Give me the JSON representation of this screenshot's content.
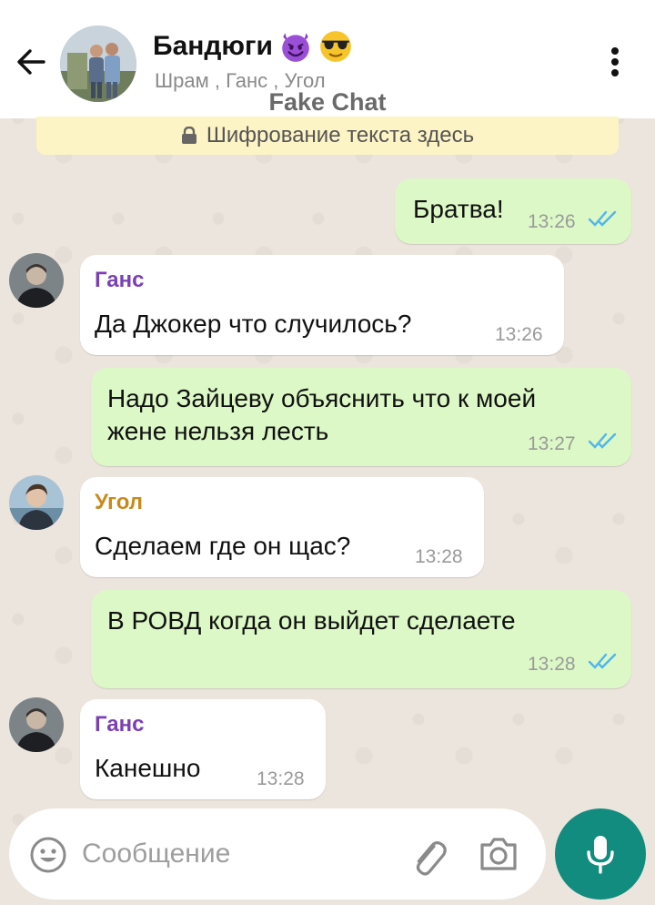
{
  "header": {
    "title": "Бандюги",
    "title_emojis": [
      "smiling-devil-emoji",
      "sunglasses-emoji"
    ],
    "members": "Шрам , Ганс , Угол",
    "watermark": "Fake Chat"
  },
  "encryption_banner": {
    "text": "Шифрование текста здесь",
    "icon": "lock-icon"
  },
  "messages": [
    {
      "direction": "out",
      "text": "Братва!",
      "time": "13:26",
      "status": "read"
    },
    {
      "direction": "in",
      "sender": "Ганс",
      "sender_color": "#7b3fb5",
      "text": "Да Джокер что случилось?",
      "time": "13:26"
    },
    {
      "direction": "out",
      "text_lines": [
        "Надо Зайцеву объяснить что к моей",
        "жене нельзя лесть"
      ],
      "time": "13:27",
      "status": "read"
    },
    {
      "direction": "in",
      "sender": "Угол",
      "sender_color": "#c88a1a",
      "text": "Сделаем где он щас?",
      "time": "13:28"
    },
    {
      "direction": "out",
      "text": "В РОВД когда он выйдет сделаете",
      "time": "13:28",
      "status": "read"
    },
    {
      "direction": "in",
      "sender": "Ганс",
      "sender_color": "#7b3fb5",
      "text": "Канешно",
      "time": "13:28"
    }
  ],
  "input": {
    "placeholder": "Сообщение"
  },
  "colors": {
    "header_bg": "#ffffff",
    "chat_bg": "#ece5dd",
    "outgoing_bubble": "#dcf8c6",
    "incoming_bubble": "#ffffff",
    "read_ticks": "#4fb6ec",
    "mic_button": "#128c7e"
  }
}
